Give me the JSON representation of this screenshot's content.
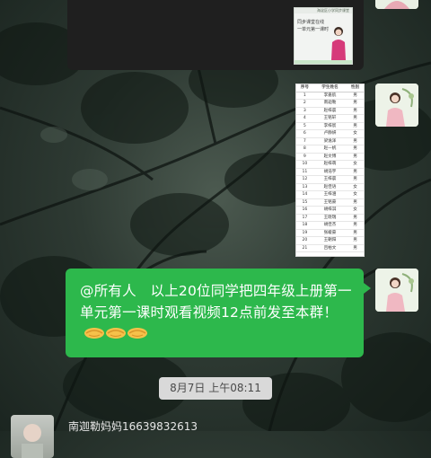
{
  "video_card": {
    "thumb_header": "海淀区小学同步课堂",
    "thumb_line1": "同步课堂在线",
    "thumb_line2": "一单元第一课时"
  },
  "roster": {
    "headers": [
      "序号",
      "学生姓名",
      "性别"
    ],
    "rows": [
      [
        "1",
        "李嘉航",
        "男"
      ],
      [
        "2",
        "南迦勒",
        "男"
      ],
      [
        "3",
        "赵梓晨",
        "男"
      ],
      [
        "4",
        "王铭轩",
        "男"
      ],
      [
        "5",
        "李梓宸",
        "男"
      ],
      [
        "6",
        "卢静妍",
        "女"
      ],
      [
        "7",
        "梁逸泽",
        "男"
      ],
      [
        "8",
        "赵一帆",
        "男"
      ],
      [
        "9",
        "赵文博",
        "男"
      ],
      [
        "10",
        "赵梓萌",
        "女"
      ],
      [
        "11",
        "胡浩宇",
        "男"
      ],
      [
        "12",
        "王梓晨",
        "男"
      ],
      [
        "13",
        "赵佳语",
        "女"
      ],
      [
        "14",
        "王梓涵",
        "女"
      ],
      [
        "15",
        "王铭豪",
        "男"
      ],
      [
        "16",
        "胡梓淇",
        "女"
      ],
      [
        "17",
        "王晓瑞",
        "男"
      ],
      [
        "18",
        "胡佳杰",
        "男"
      ],
      [
        "19",
        "张峻豪",
        "男"
      ],
      [
        "20",
        "王朝阳",
        "男"
      ],
      [
        "21",
        "吕柏文",
        "男"
      ]
    ]
  },
  "message": {
    "text": "@所有人　以上20位同学把四年级上册第一单元第一课时观看视频12点前发至本群！",
    "emoji": "handshake-emoji",
    "emoji_count": 3
  },
  "timestamp": "8月7日 上午08:11",
  "next_sender": {
    "name": "南迦勒妈妈16639832613"
  },
  "colors": {
    "bubble": "#2db84c",
    "bubble_text": "#ffffff",
    "time_pill": "#d9d9d9",
    "video_card": "#1f1f1f"
  }
}
